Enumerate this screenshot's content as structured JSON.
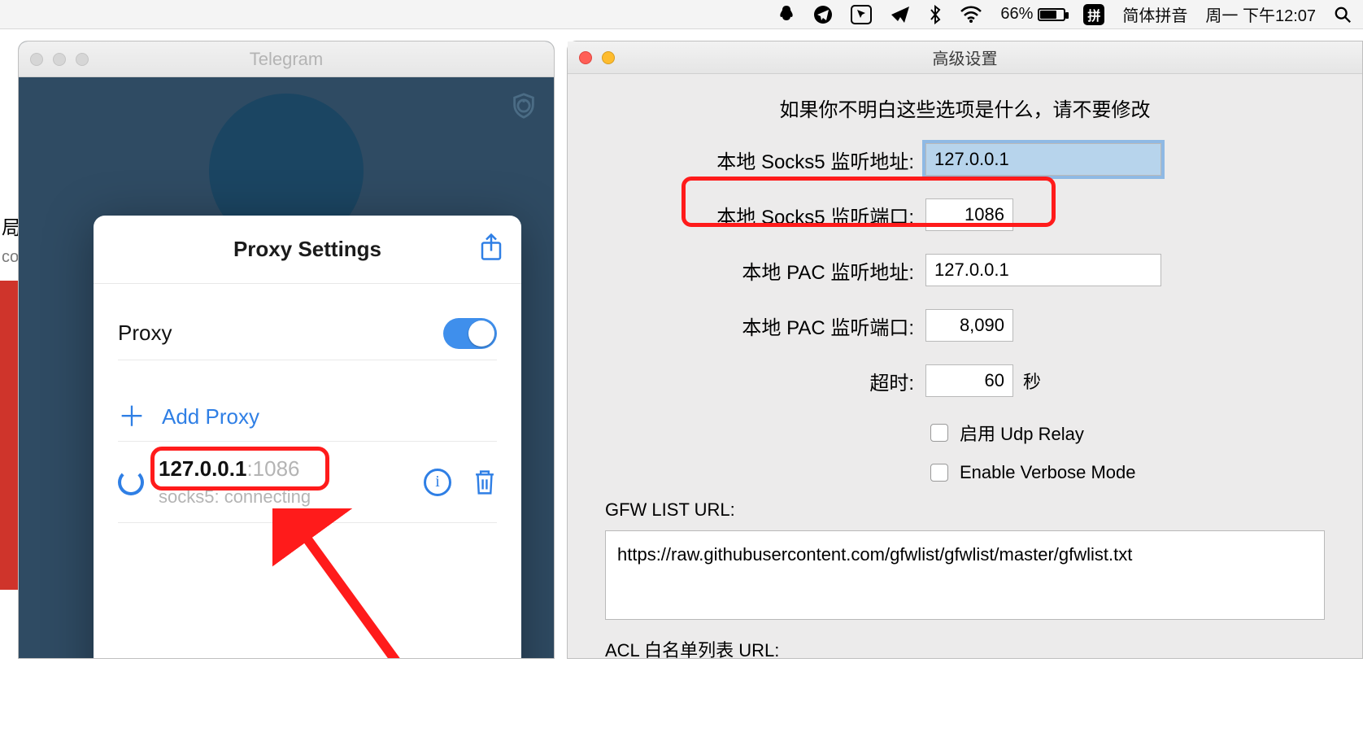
{
  "menubar": {
    "battery_pct": "66%",
    "ime_badge": "拼",
    "ime_label": "简体拼音",
    "clock": "周一 下午12:07"
  },
  "telegram": {
    "window_title": "Telegram",
    "modal_title": "Proxy Settings",
    "proxy_label": "Proxy",
    "add_proxy_label": "Add Proxy",
    "proxy_item": {
      "host": "127.0.0.1",
      "port_display": ":1086",
      "status": "socks5: connecting"
    },
    "sidebar_fragment": {
      "label1": "局",
      "label2": "co"
    }
  },
  "settings": {
    "window_title": "高级设置",
    "note": "如果你不明白这些选项是什么，请不要修改",
    "rows": {
      "socks5_addr_label": "本地 Socks5 监听地址:",
      "socks5_addr_value": "127.0.0.1",
      "socks5_port_label": "本地 Socks5 监听端口:",
      "socks5_port_value": "1086",
      "pac_addr_label": "本地 PAC 监听地址:",
      "pac_addr_value": "127.0.0.1",
      "pac_port_label": "本地 PAC 监听端口:",
      "pac_port_value": "8,090",
      "timeout_label": "超时:",
      "timeout_value": "60",
      "timeout_suffix": "秒",
      "udp_relay_label": "启用 Udp Relay",
      "verbose_label": "Enable Verbose Mode"
    },
    "gfw_section_label": "GFW LIST URL:",
    "gfw_url": "https://raw.githubusercontent.com/gfwlist/gfwlist/master/gfwlist.txt",
    "acl_section_label": "ACL 白名单列表 URL:"
  }
}
